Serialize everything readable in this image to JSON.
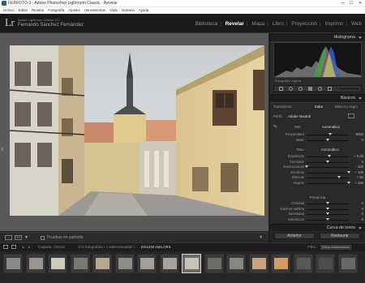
{
  "window": {
    "title": "FERFOTO-3 - Adobe Photoshop Lightroom Classic - Revelar",
    "minimize": "—",
    "maximize": "☐",
    "close": "✕"
  },
  "menu": [
    "Archivo",
    "Editar",
    "Revelar",
    "Fotografía",
    "Ajustes",
    "Herramientas",
    "Vista",
    "Ventana",
    "Ayuda"
  ],
  "identity": {
    "logo": "Lr",
    "product": "Adobe Lightroom Classic CC",
    "user": "Fernando Sánchez Fernández"
  },
  "modules": [
    {
      "label": "Biblioteca",
      "active": false
    },
    {
      "label": "Revelar",
      "active": true
    },
    {
      "label": "Mapa",
      "active": false
    },
    {
      "label": "Libro",
      "active": false
    },
    {
      "label": "Proyección",
      "active": false
    },
    {
      "label": "Imprimir",
      "active": false
    },
    {
      "label": "Web",
      "active": false
    }
  ],
  "toolbar": {
    "proof_label": "Pruebas en pantalla"
  },
  "right_panel": {
    "histogram_label": "Histograma",
    "original_photo_label": "Fotografía original",
    "basic_label": "Básicos",
    "treatment_label": "Tratamiento:",
    "treatment_color": "Color",
    "treatment_bw": "Blanco y negro",
    "profile_label": "Perfil:",
    "profile_value": "Adobe Neutral",
    "wb_label": "WB:",
    "wb_value": "Automático",
    "tone_label": "Tono",
    "tone_auto": "Automático",
    "presence_label": "Presencia",
    "tone_curve_label": "Curva de tonos",
    "sliders_wb": [
      {
        "name": "Temperatura",
        "value": "5850",
        "level": 0.55
      },
      {
        "name": "Matiz",
        "value": "0",
        "level": 0.5
      }
    ],
    "sliders_tone": [
      {
        "name": "Exposición",
        "value": "+ 0,33",
        "level": 0.53
      },
      {
        "name": "Contraste",
        "value": "0",
        "level": 0.5
      },
      {
        "name": "Iluminaciones",
        "value": "- 100",
        "level": 0.0
      },
      {
        "name": "Sombras",
        "value": "+ 100",
        "level": 1.0
      },
      {
        "name": "Blancos",
        "value": "+ 54",
        "level": 0.77
      },
      {
        "name": "Negros",
        "value": "+ 100",
        "level": 1.0
      }
    ],
    "sliders_presence": [
      {
        "name": "Claridad",
        "value": "0",
        "level": 0.5
      },
      {
        "name": "Eliminar neblina",
        "value": "0",
        "level": 0.5
      },
      {
        "name": "Intensidad",
        "value": "0",
        "level": 0.5
      },
      {
        "name": "Saturación",
        "value": "0",
        "level": 0.5
      }
    ],
    "previous_button": "Anterior",
    "reset_button": "Restaurar"
  },
  "filmstrip_bar": {
    "folder": "Carpeta : 01244",
    "count": "174 fotografías / 1 seleccionadas /",
    "filename": "DX1244-044.CR3",
    "filter_label": "Filtro :",
    "filter_value": "Filtros desactivados"
  },
  "filmstrip": {
    "thumbnails": 16,
    "selected_index": 8
  }
}
